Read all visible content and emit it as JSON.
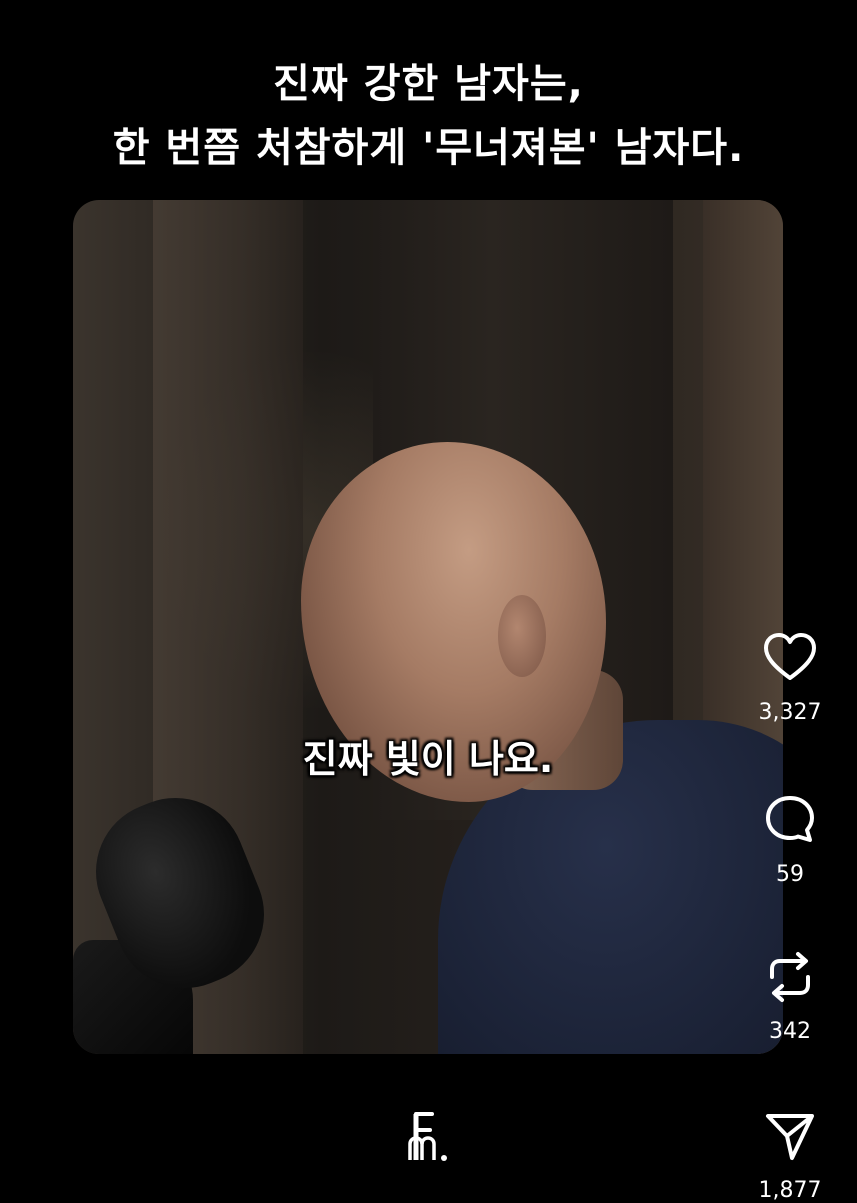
{
  "headline": {
    "line1": "진짜 강한 남자는,",
    "line2": "한 번쯤 처참하게 '무너져본' 남자다."
  },
  "video": {
    "caption": "진짜 빛이 나요."
  },
  "actions": {
    "like": {
      "icon": "heart-icon",
      "count": "3,327"
    },
    "comment": {
      "icon": "comment-bubble-icon",
      "count": "59"
    },
    "repost": {
      "icon": "repost-arrows-icon",
      "count": "342"
    },
    "share": {
      "icon": "send-paper-plane-icon",
      "count": "1,877"
    }
  },
  "logo": {
    "icon": "channel-logo-icon"
  },
  "colors": {
    "background": "#000000",
    "text": "#ffffff"
  }
}
